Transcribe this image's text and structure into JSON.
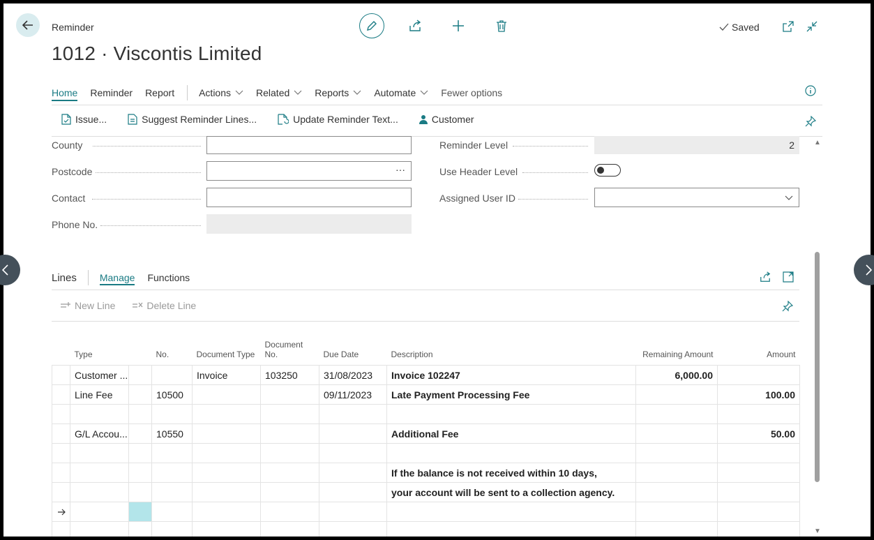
{
  "header": {
    "breadcrumb": "Reminder",
    "title": "1012 · Viscontis Limited",
    "saved_label": "Saved"
  },
  "nav": {
    "tabs": [
      "Home",
      "Reminder",
      "Report"
    ],
    "menus": [
      "Actions",
      "Related",
      "Reports",
      "Automate"
    ],
    "fewer": "Fewer options"
  },
  "actions": {
    "issue": "Issue...",
    "suggest": "Suggest Reminder Lines...",
    "update": "Update Reminder Text...",
    "customer": "Customer"
  },
  "form": {
    "county_label": "County",
    "county_value": "",
    "postcode_label": "Postcode",
    "postcode_value": "",
    "postcode_more": "···",
    "contact_label": "Contact",
    "contact_value": "",
    "phone_label": "Phone No.",
    "phone_value": "",
    "level_label": "Reminder Level",
    "level_value": "2",
    "use_header_label": "Use Header Level",
    "use_header_value": "off",
    "assigned_label": "Assigned User ID",
    "assigned_value": ""
  },
  "lines": {
    "title": "Lines",
    "tabs": [
      "Manage",
      "Functions"
    ],
    "new_line": "New Line",
    "delete_line": "Delete Line",
    "columns": {
      "type": "Type",
      "no": "No.",
      "doc_type": "Document Type",
      "doc_no": "Document No.",
      "due": "Due Date",
      "desc": "Description",
      "remaining": "Remaining Amount",
      "amount": "Amount"
    },
    "rows": [
      {
        "type": "Customer ...",
        "no": "",
        "doc_type": "Invoice",
        "doc_no": "103250",
        "due": "31/08/2023",
        "desc": "Invoice 102247",
        "remaining": "6,000.00",
        "amount": ""
      },
      {
        "type": "Line Fee",
        "no": "10500",
        "doc_type": "",
        "doc_no": "",
        "due": "09/11/2023",
        "desc": "Late Payment Processing Fee",
        "remaining": "",
        "amount": "100.00"
      },
      {
        "type": "",
        "no": "",
        "doc_type": "",
        "doc_no": "",
        "due": "",
        "desc": "",
        "remaining": "",
        "amount": ""
      },
      {
        "type": "G/L Accou...",
        "no": "10550",
        "doc_type": "",
        "doc_no": "",
        "due": "",
        "desc": "Additional Fee",
        "remaining": "",
        "amount": "50.00"
      },
      {
        "type": "",
        "no": "",
        "doc_type": "",
        "doc_no": "",
        "due": "",
        "desc": "",
        "remaining": "",
        "amount": ""
      },
      {
        "type": "",
        "no": "",
        "doc_type": "",
        "doc_no": "",
        "due": "",
        "desc": "If the balance is not received within 10 days,",
        "remaining": "",
        "amount": ""
      },
      {
        "type": "",
        "no": "",
        "doc_type": "",
        "doc_no": "",
        "due": "",
        "desc": "your account will be sent to a collection agency.",
        "remaining": "",
        "amount": ""
      },
      {
        "type": "",
        "no": "",
        "doc_type": "",
        "doc_no": "",
        "due": "",
        "desc": "",
        "remaining": "",
        "amount": ""
      },
      {
        "type": "",
        "no": "",
        "doc_type": "",
        "doc_no": "",
        "due": "",
        "desc": "",
        "remaining": "",
        "amount": ""
      }
    ]
  },
  "colors": {
    "accent": "#1a7b84",
    "selected_cell": "#b3e5ea"
  }
}
